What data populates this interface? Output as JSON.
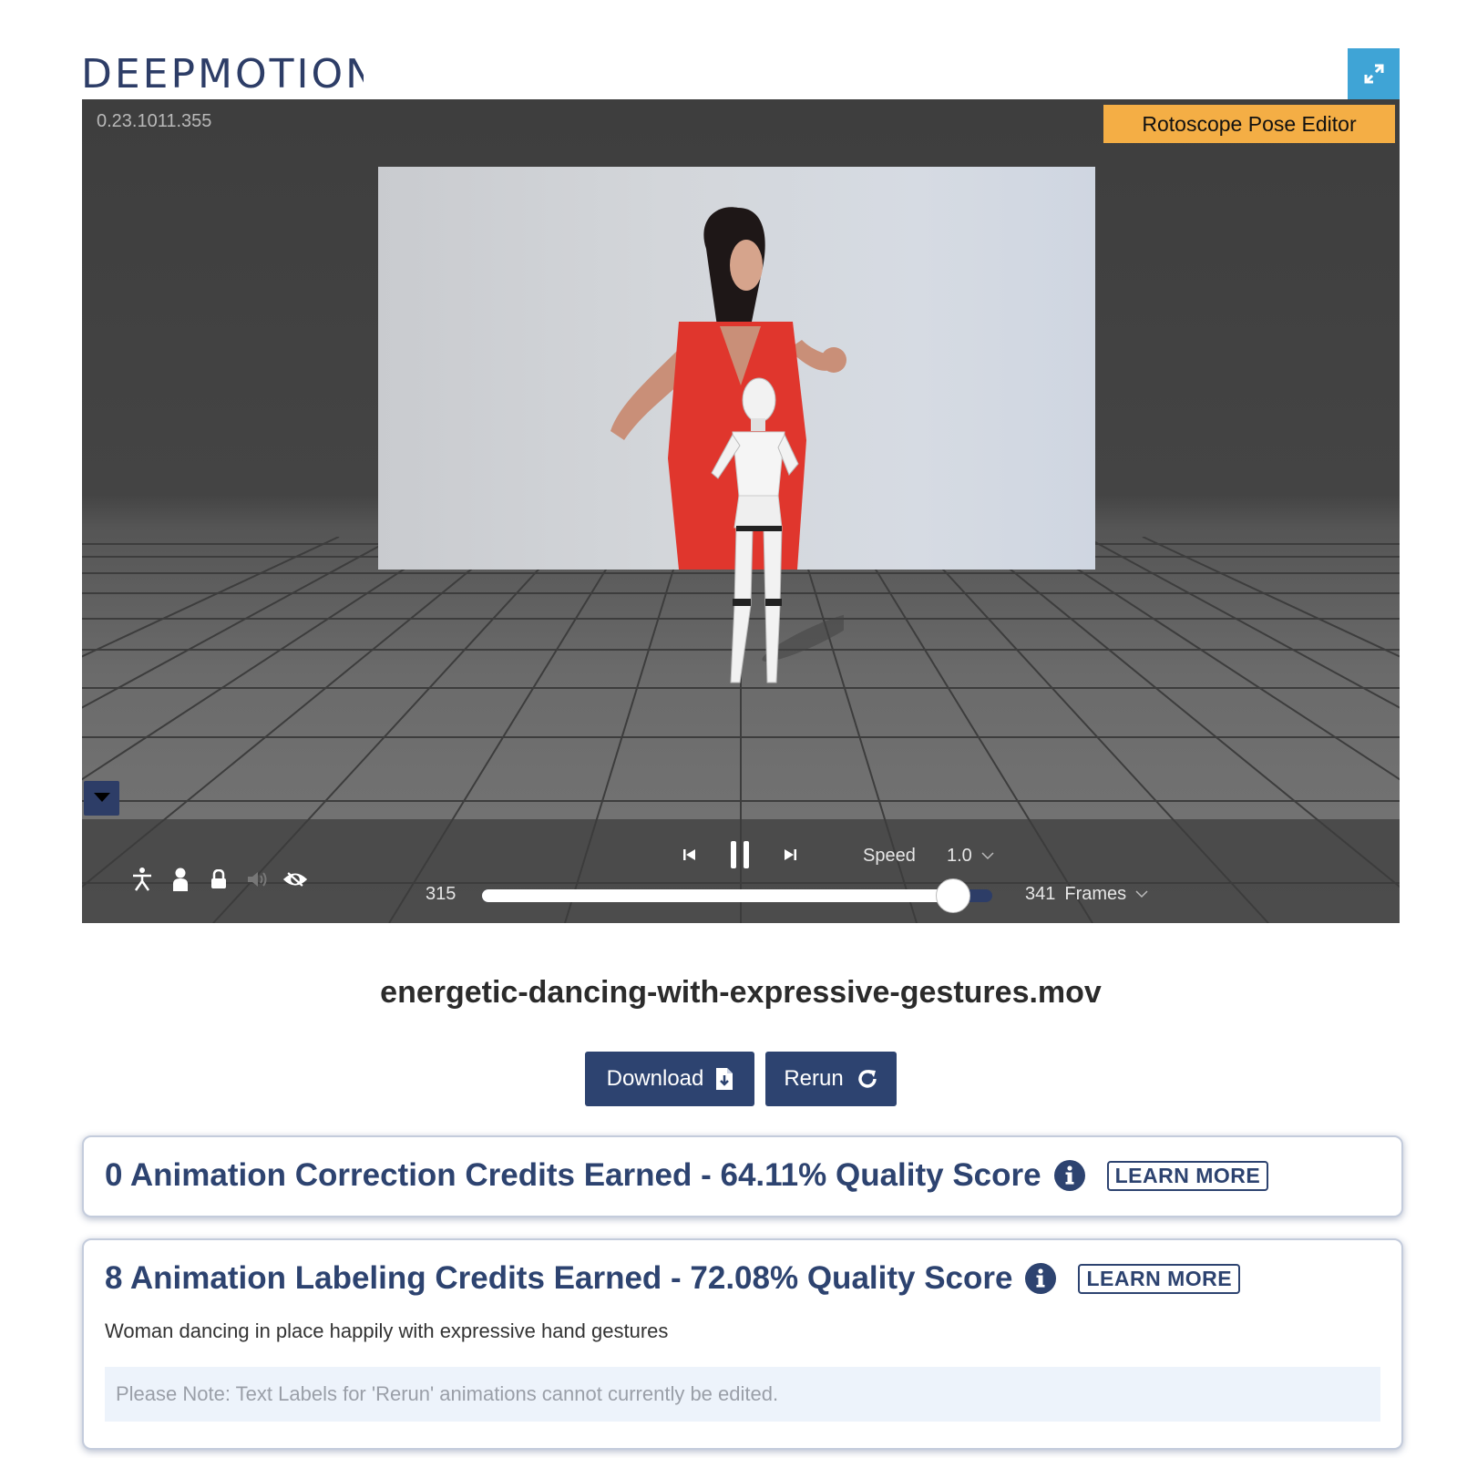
{
  "header": {
    "logo_text": "DEEPMOTION",
    "expand_icon": "expand-arrows-icon"
  },
  "viewer": {
    "version": "0.23.1011.355",
    "roto_button": "Rotoscope Pose Editor",
    "collapse_icon": "caret-down-icon",
    "tool_icons": [
      "skeleton-icon",
      "avatar-icon",
      "lock-icon",
      "volume-icon",
      "eye-icon"
    ],
    "playback_icons": [
      "skip-back-icon",
      "pause-icon",
      "skip-forward-icon"
    ],
    "speed_label": "Speed",
    "speed_value": "1.0",
    "current_frame": "315",
    "total_frames": "341",
    "frames_label": "Frames",
    "progress": 0.924
  },
  "file": {
    "name": "energetic-dancing-with-expressive-gestures.mov"
  },
  "actions": {
    "download_label": "Download",
    "rerun_label": "Rerun"
  },
  "cards": {
    "correction": {
      "title": "0 Animation Correction Credits Earned - 64.11% Quality Score",
      "learn_more": "LEARN MORE"
    },
    "labeling": {
      "title": "8 Animation Labeling Credits Earned - 72.08% Quality Score",
      "learn_more": "LEARN MORE",
      "label_text": "Woman dancing in place happily with expressive hand gestures",
      "note": "Please Note: Text Labels for 'Rerun' animations cannot currently be edited."
    }
  },
  "colors": {
    "brand": "#2d3d67",
    "accent_orange": "#f4ae45",
    "expand_blue": "#3fa4d6",
    "button_navy": "#2d4370"
  }
}
